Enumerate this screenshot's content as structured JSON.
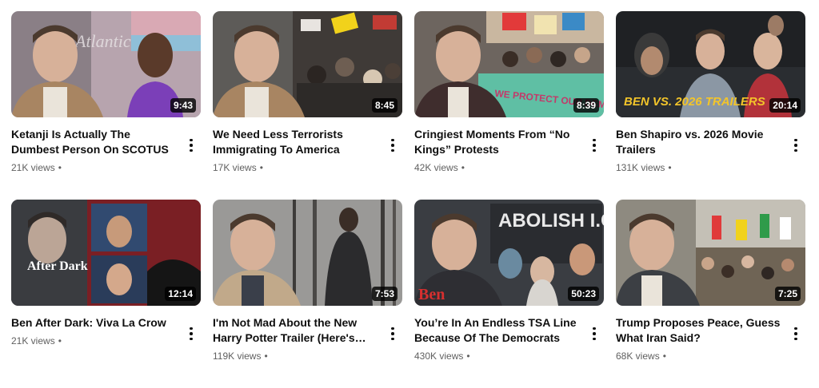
{
  "videos": [
    {
      "title": "Ketanji Is Actually The Dumbest Person On SCOTUS",
      "views": "21K views",
      "sep": "•",
      "duration": "9:43",
      "thumb_text": "Atlantic"
    },
    {
      "title": "We Need Less Terrorists Immigrating To America",
      "views": "17K views",
      "sep": "•",
      "duration": "8:45",
      "thumb_text": ""
    },
    {
      "title": "Cringiest Moments From “No Kings” Protests",
      "views": "42K views",
      "sep": "•",
      "duration": "8:39",
      "thumb_text": "WE PROTECT OUR DEMOCRACY"
    },
    {
      "title": "Ben Shapiro vs. 2026 Movie Trailers",
      "views": "131K views",
      "sep": "•",
      "duration": "20:14",
      "thumb_text": "BEN VS. 2026 TRAILERS"
    },
    {
      "title": "Ben After Dark: Viva La Crow",
      "views": "21K views",
      "sep": "•",
      "duration": "12:14",
      "thumb_text": "After Dark"
    },
    {
      "title": "I'm Not Mad About the New Harry Potter Trailer (Here's Why)",
      "views": "119K views",
      "sep": "•",
      "duration": "7:53",
      "thumb_text": ""
    },
    {
      "title": "You’re In An Endless TSA Line Because Of The Democrats",
      "views": "430K views",
      "sep": "•",
      "duration": "50:23",
      "thumb_text": "ABOLISH I.C.E.",
      "thumb_text2": "Ben"
    },
    {
      "title": "Trump Proposes Peace, Guess What Iran Said?",
      "views": "68K views",
      "sep": "•",
      "duration": "7:25",
      "thumb_text": ""
    }
  ]
}
